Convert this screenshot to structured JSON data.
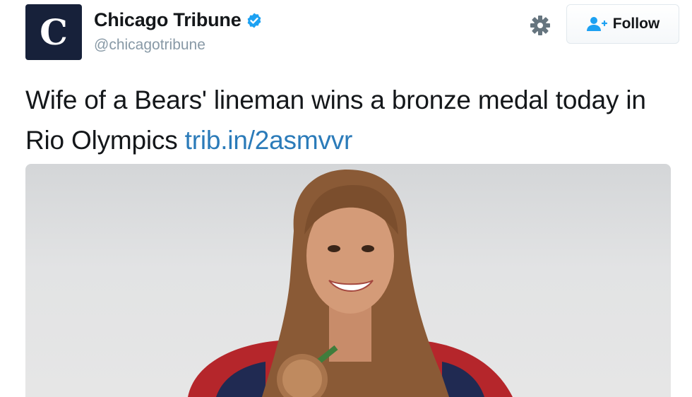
{
  "account": {
    "display_name": "Chicago Tribune",
    "handle": "@chicagotribune",
    "verified": true,
    "avatar_letter": "C",
    "avatar_bg": "#17213a"
  },
  "actions": {
    "settings_icon": "gear-icon",
    "follow_icon": "add-user-icon",
    "follow_label": "Follow"
  },
  "tweet": {
    "text": "Wife of a Bears' lineman wins a bronze medal today in Rio Olympics",
    "link_text": "trib.in/2asmvvr",
    "link_color": "#2b7bb9"
  },
  "media": {
    "description_icon": "photo-athlete-with-bronze-medal"
  }
}
